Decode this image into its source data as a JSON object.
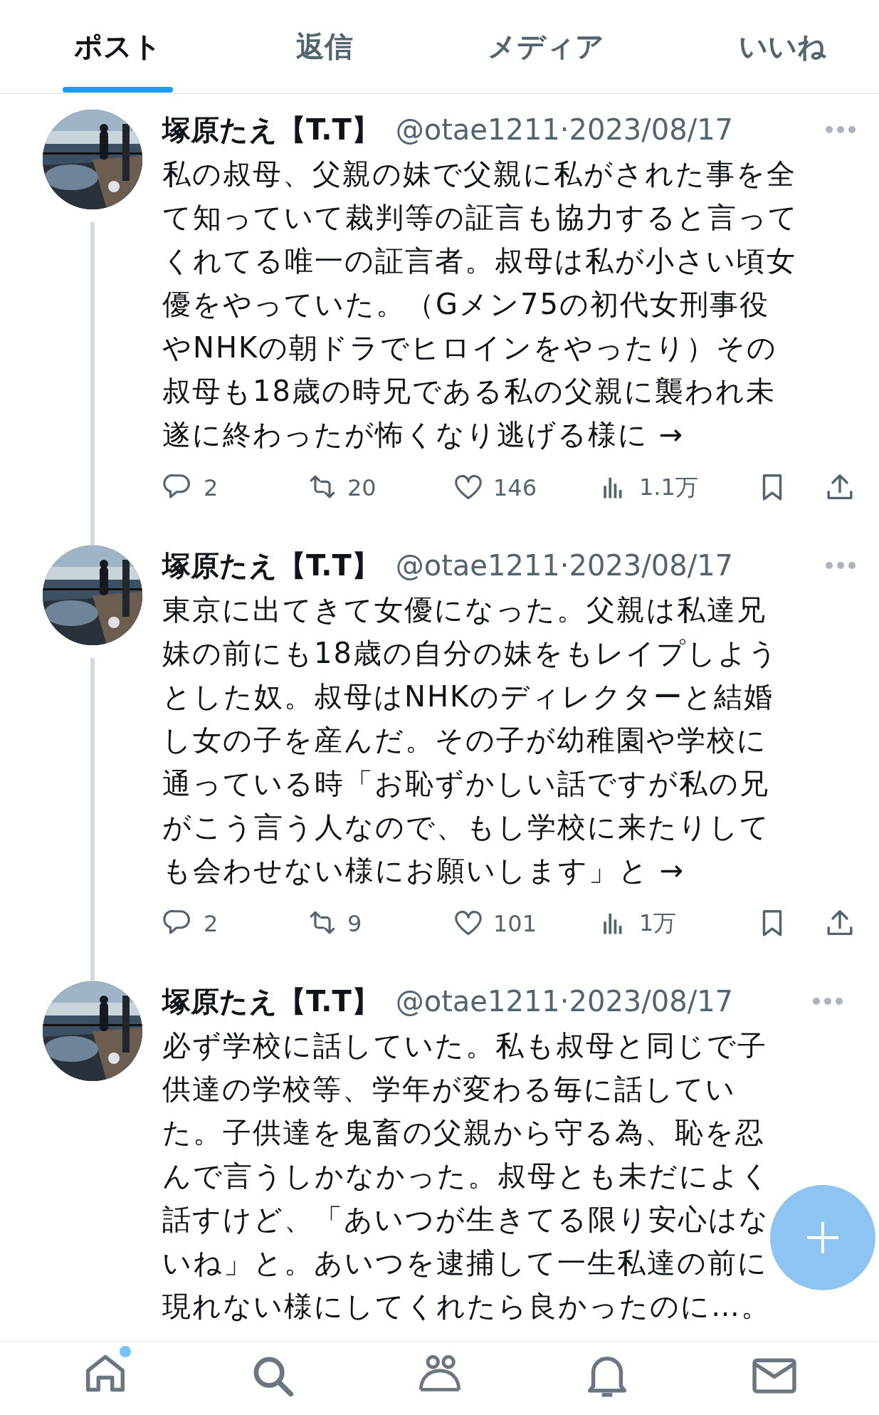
{
  "tabs": [
    {
      "label": "ポスト",
      "selected": true
    },
    {
      "label": "返信",
      "selected": false
    },
    {
      "label": "メディア",
      "selected": false
    },
    {
      "label": "いいね",
      "selected": false
    }
  ],
  "posts": [
    {
      "name": "塚原たえ【T.T】",
      "meta": "@otae1211·2023/08/17",
      "text_lines": [
        "私の叔母、父親の妹で父親に私がされた事を全",
        "て知っていて裁判等の証言も協力すると言って",
        "くれてる唯一の証言者。叔母は私が小さい頃女",
        "優をやっていた。（Gメン75の初代女刑事役",
        "やNHKの朝ドラでヒロインをやったり）その",
        "叔母も18歳の時兄である私の父親に襲われ未",
        "遂に終わったが怖くなり逃げる様に →"
      ],
      "replies": "2",
      "reposts": "20",
      "likes": "146",
      "views": "1.1万",
      "thread_line": true
    },
    {
      "name": "塚原たえ【T.T】",
      "meta": "@otae1211·2023/08/17",
      "text_lines": [
        "東京に出てきて女優になった。父親は私達兄",
        "妹の前にも18歳の自分の妹をもレイプしよう",
        "とした奴。叔母はNHKのディレクターと結婚",
        "し女の子を産んだ。その子が幼稚園や学校に",
        "通っている時「お恥ずかしい話ですが私の兄",
        "がこう言う人なので、もし学校に来たりして",
        "も会わせない様にお願いします」と →"
      ],
      "replies": "2",
      "reposts": "9",
      "likes": "101",
      "views": "1万",
      "thread_line": true
    },
    {
      "name": "塚原たえ【T.T】",
      "meta": "@otae1211·2023/08/17",
      "text_lines": [
        "必ず学校に話していた。私も叔母と同じで子",
        "供達の学校等、学年が変わる毎に話してい",
        "た。子供達を鬼畜の父親から守る為、恥を忍",
        "んで言うしかなかった。叔母とも未だによく",
        "話すけど、「あいつが生きてる限り安心はな",
        "いね」と。あいつを逮捕して一生私達の前に",
        "現れない様にしてくれたら良かったのに…。"
      ],
      "thread_line": false
    }
  ],
  "bottom_nav": [
    {
      "kind": "home",
      "badge": true
    },
    {
      "kind": "search",
      "badge": false
    },
    {
      "kind": "people",
      "badge": false
    },
    {
      "kind": "bell",
      "badge": false
    },
    {
      "kind": "mail",
      "badge": false
    }
  ]
}
